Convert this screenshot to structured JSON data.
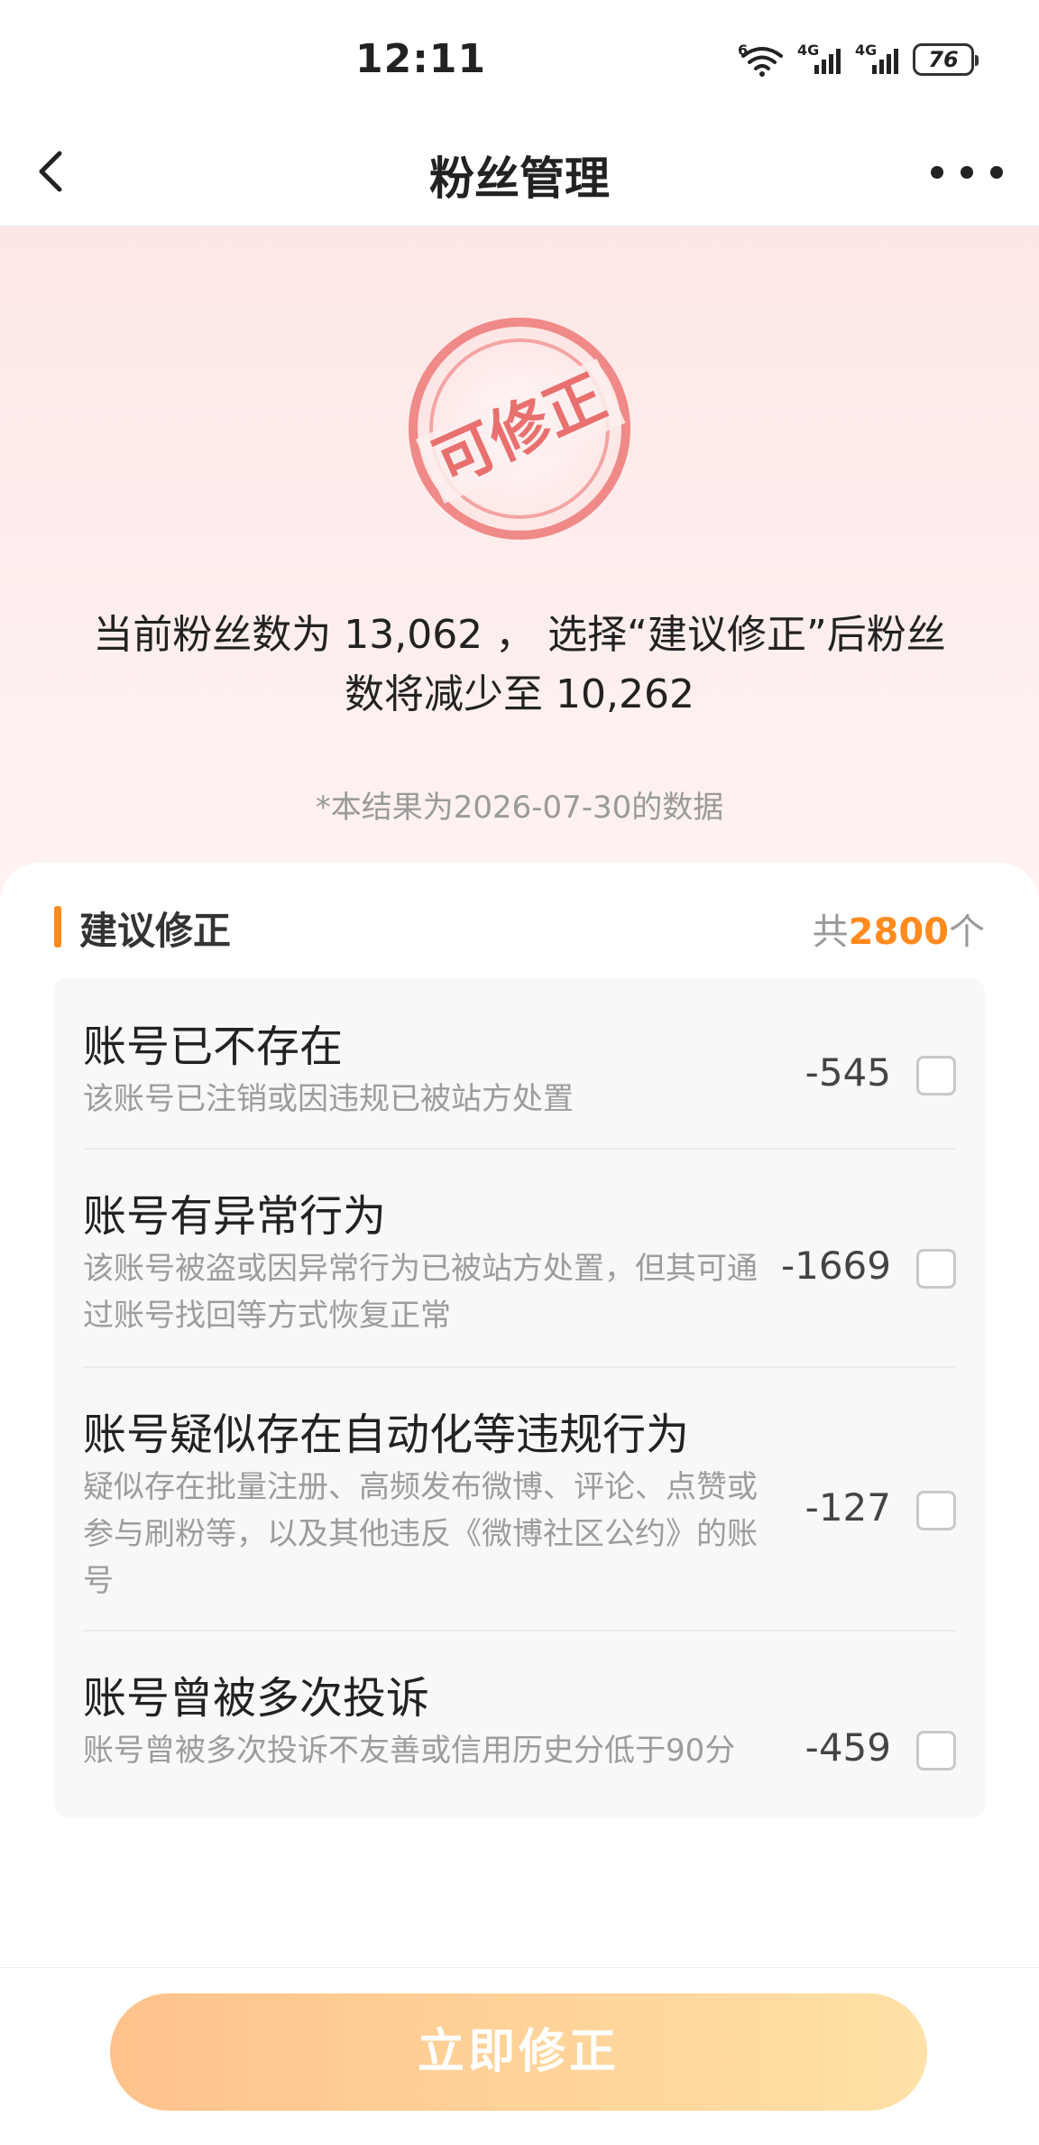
{
  "status_bar": {
    "time": "12:11",
    "wifi_tag": "6",
    "sim1_tag": "4G",
    "sim2_tag": "4G",
    "battery": "76"
  },
  "nav": {
    "title": "粉丝管理",
    "back_icon": "chevron-left-icon",
    "more_icon": "more-horizontal-icon"
  },
  "hero": {
    "stamp_text": "可修正",
    "summary_line1": "当前粉丝数为 13,062 ，  选择“建议修正”后粉丝",
    "summary_line2": "数将减少至 10,262",
    "data_note": "*本结果为2026-07-30的数据"
  },
  "section": {
    "title": "建议修正",
    "total_prefix": "共",
    "total_count": "2800",
    "total_suffix": "个"
  },
  "items": [
    {
      "title": "账号已不存在",
      "desc": "该账号已注销或因违规已被站方处置",
      "count": "-545"
    },
    {
      "title": "账号有异常行为",
      "desc": "该账号被盗或因异常行为已被站方处置，但其可通过账号找回等方式恢复正常",
      "count": "-1669"
    },
    {
      "title": "账号疑似存在自动化等违规行为",
      "desc": "疑似存在批量注册、高频发布微博、评论、点赞或参与刷粉等，以及其他违反《微博社区公约》的账号",
      "count": "-127"
    },
    {
      "title": "账号曾被多次投诉",
      "desc": "账号曾被多次投诉不友善或信用历史分低于90分",
      "count": "-459"
    }
  ],
  "action": {
    "button_label": "立即修正"
  },
  "colors": {
    "accent": "#ff8a1e",
    "stamp": "#e8706e",
    "button_start": "#ffc28c",
    "button_end": "#ffe0a6"
  }
}
